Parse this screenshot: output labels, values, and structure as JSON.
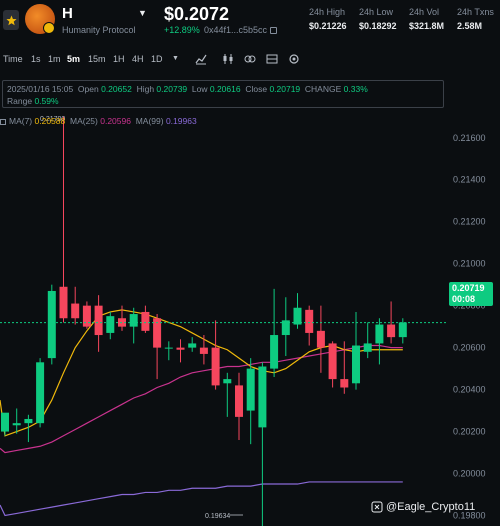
{
  "header": {
    "ticker": "H",
    "name": "Humanity Protocol",
    "price": "$0.2072",
    "change": "+12.89%",
    "contract": "0x44f1...c5b5cc",
    "stats": [
      {
        "label": "24h High",
        "value": "$0.21226"
      },
      {
        "label": "24h Low",
        "value": "$0.18292"
      },
      {
        "label": "24h Vol",
        "value": "$321.8M"
      },
      {
        "label": "24h Txns",
        "value": "2.58M"
      }
    ]
  },
  "toolbar": {
    "time_label": "Time",
    "intervals": [
      "1s",
      "1m",
      "5m",
      "15m",
      "1H",
      "4H",
      "1D"
    ],
    "active_interval": "5m",
    "icons": [
      "line-chart-icon",
      "indicator-icon",
      "compare-icon",
      "layout-icon",
      "settings-icon"
    ]
  },
  "legend": {
    "date": "2025/01/16 15:05",
    "open_label": "Open",
    "open": "0.20652",
    "high_label": "High",
    "high": "0.20739",
    "low_label": "Low",
    "low": "0.20616",
    "close_label": "Close",
    "close": "0.20719",
    "change_label": "CHANGE",
    "change": "0.33%",
    "range_label": "Range",
    "range": "0.59%"
  },
  "ma_legend": {
    "ma7_label": "MA(7)",
    "ma7": "0.20588",
    "ma25_label": "MA(25)",
    "ma25": "0.20596",
    "ma99_label": "MA(99)",
    "ma99": "0.19963"
  },
  "price_tag": {
    "price": "0.20719",
    "countdown": "00:08"
  },
  "watermark": "@Eagle_Crypto11",
  "colors": {
    "up": "#0ecb81",
    "down": "#f6465d",
    "ma7": "#f0b90b",
    "ma25": "#c9338f",
    "ma99": "#8a6ad8"
  },
  "chart_data": {
    "type": "candlestick",
    "y_ticks": [
      "0.21600",
      "0.21400",
      "0.21200",
      "0.21000",
      "0.20800",
      "0.20600",
      "0.20400",
      "0.20200",
      "0.20000",
      "0.19800"
    ],
    "ylim": [
      0.1975,
      0.2178
    ],
    "annotations": [
      {
        "text": "0.21700"
      },
      {
        "text": "0.19634"
      }
    ],
    "candles": [
      {
        "o": 0.202,
        "h": 0.2028,
        "c": 0.2029,
        "l": 0.2018
      },
      {
        "o": 0.2023,
        "h": 0.2031,
        "c": 0.2024,
        "l": 0.2019
      },
      {
        "o": 0.2024,
        "h": 0.2028,
        "c": 0.2026,
        "l": 0.2015
      },
      {
        "o": 0.2024,
        "h": 0.2055,
        "c": 0.2053,
        "l": 0.2022
      },
      {
        "o": 0.2055,
        "h": 0.209,
        "c": 0.2087,
        "l": 0.2052
      },
      {
        "o": 0.2089,
        "h": 0.217,
        "c": 0.2074,
        "l": 0.2072
      },
      {
        "o": 0.2081,
        "h": 0.2089,
        "c": 0.2074,
        "l": 0.2071
      },
      {
        "o": 0.208,
        "h": 0.2082,
        "c": 0.207,
        "l": 0.2069
      },
      {
        "o": 0.208,
        "h": 0.2085,
        "c": 0.2066,
        "l": 0.2058
      },
      {
        "o": 0.2067,
        "h": 0.2077,
        "c": 0.2075,
        "l": 0.2064
      },
      {
        "o": 0.2074,
        "h": 0.208,
        "c": 0.207,
        "l": 0.2068
      },
      {
        "o": 0.207,
        "h": 0.2079,
        "c": 0.2076,
        "l": 0.2062
      },
      {
        "o": 0.2077,
        "h": 0.208,
        "c": 0.2068,
        "l": 0.2067
      },
      {
        "o": 0.2074,
        "h": 0.2076,
        "c": 0.206,
        "l": 0.2045
      },
      {
        "o": 0.206,
        "h": 0.2063,
        "c": 0.206,
        "l": 0.2054
      },
      {
        "o": 0.206,
        "h": 0.2064,
        "c": 0.2059,
        "l": 0.2053
      },
      {
        "o": 0.206,
        "h": 0.2065,
        "c": 0.2062,
        "l": 0.2058
      },
      {
        "o": 0.206,
        "h": 0.2066,
        "c": 0.2057,
        "l": 0.2052
      },
      {
        "o": 0.206,
        "h": 0.2073,
        "c": 0.2042,
        "l": 0.204
      },
      {
        "o": 0.2043,
        "h": 0.2048,
        "c": 0.2045,
        "l": 0.2027
      },
      {
        "o": 0.2042,
        "h": 0.2048,
        "c": 0.2027,
        "l": 0.2016
      },
      {
        "o": 0.203,
        "h": 0.2055,
        "c": 0.205,
        "l": 0.2014
      },
      {
        "o": 0.2022,
        "h": 0.2053,
        "c": 0.2051,
        "l": 0.1963
      },
      {
        "o": 0.205,
        "h": 0.2088,
        "c": 0.2066,
        "l": 0.2046
      },
      {
        "o": 0.2066,
        "h": 0.2084,
        "c": 0.2073,
        "l": 0.2056
      },
      {
        "o": 0.2071,
        "h": 0.2086,
        "c": 0.2079,
        "l": 0.2069
      },
      {
        "o": 0.2078,
        "h": 0.208,
        "c": 0.2067,
        "l": 0.2061
      },
      {
        "o": 0.2068,
        "h": 0.208,
        "c": 0.206,
        "l": 0.2048
      },
      {
        "o": 0.2062,
        "h": 0.2063,
        "c": 0.2045,
        "l": 0.2041
      },
      {
        "o": 0.2045,
        "h": 0.2063,
        "c": 0.2041,
        "l": 0.2038
      },
      {
        "o": 0.2043,
        "h": 0.2077,
        "c": 0.2061,
        "l": 0.204
      },
      {
        "o": 0.2058,
        "h": 0.2072,
        "c": 0.2062,
        "l": 0.2055
      },
      {
        "o": 0.2062,
        "h": 0.2074,
        "c": 0.2071,
        "l": 0.2052
      },
      {
        "o": 0.2071,
        "h": 0.2082,
        "c": 0.2065,
        "l": 0.2062
      },
      {
        "o": 0.2065,
        "h": 0.2074,
        "c": 0.2072,
        "l": 0.2062
      }
    ],
    "ma7": [
      0.2018,
      0.202,
      0.2022,
      0.2025,
      0.2035,
      0.2048,
      0.206,
      0.2068,
      0.2075,
      0.2077,
      0.2078,
      0.2077,
      0.2076,
      0.2074,
      0.2072,
      0.207,
      0.2067,
      0.2064,
      0.2061,
      0.2059,
      0.2055,
      0.2051,
      0.2049,
      0.2048,
      0.205,
      0.2054,
      0.2058,
      0.206,
      0.2061,
      0.2059,
      0.2058,
      0.2059,
      0.2059,
      0.2059,
      0.2059
    ],
    "ma25": [
      0.201,
      0.2011,
      0.2012,
      0.2013,
      0.2015,
      0.2018,
      0.2021,
      0.2024,
      0.2027,
      0.203,
      0.2033,
      0.2036,
      0.2038,
      0.2041,
      0.2043,
      0.2046,
      0.2048,
      0.2049,
      0.205,
      0.2051,
      0.2051,
      0.2052,
      0.2053,
      0.2053,
      0.2054,
      0.2055,
      0.2056,
      0.2057,
      0.2058,
      0.2059,
      0.206,
      0.2061,
      0.2061,
      0.206,
      0.206
    ],
    "ma99": [
      0.198,
      0.1981,
      0.1982,
      0.1983,
      0.1984,
      0.1985,
      0.1986,
      0.1987,
      0.1988,
      0.1989,
      0.199,
      0.199,
      0.1991,
      0.1991,
      0.1992,
      0.1992,
      0.1993,
      0.1993,
      0.1993,
      0.1994,
      0.1994,
      0.1994,
      0.1995,
      0.1995,
      0.1995,
      0.1995,
      0.1996,
      0.1996,
      0.1996,
      0.1996,
      0.1996,
      0.1996,
      0.1996,
      0.1996,
      0.1996
    ],
    "ma_line_start": [
      0.2035,
      0.2012,
      0.1985
    ],
    "last_price": 0.20719
  }
}
